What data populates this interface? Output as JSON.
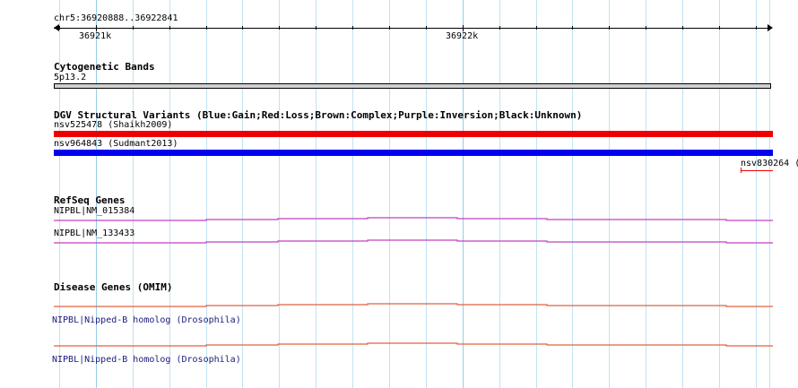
{
  "colors": {
    "grid": "#bfe3f3",
    "gain": "#0000ee",
    "loss": "#ee0000",
    "refseq": "#c040c0",
    "omim": "#e06040",
    "band": "#d0d0d0"
  },
  "ruler": {
    "region": "chr5:36920888..36922841",
    "tick_labels": [
      "36921k",
      "36922k"
    ]
  },
  "cytoband": {
    "title": "Cytogenetic Bands",
    "band_label": "5p13.2"
  },
  "dgv": {
    "title": "DGV Structural Variants (Blue:Gain;Red:Loss;Brown:Complex;Purple:Inversion;Black:Unknown)",
    "variants": [
      {
        "label": "nsv525478 (Shaikh2009)",
        "type": "loss"
      },
      {
        "label": "nsv964843 (Sudmant2013)",
        "type": "gain"
      },
      {
        "label": "nsv830264 (",
        "type": "loss"
      }
    ]
  },
  "refseq": {
    "title": "RefSeq Genes",
    "genes": [
      "NIPBL|NM_015384",
      "NIPBL|NM_133433"
    ]
  },
  "omim": {
    "title": "Disease Genes (OMIM)",
    "genes": [
      "NIPBL|Nipped-B homolog (Drosophila)",
      "NIPBL|Nipped-B homolog (Drosophila)"
    ]
  }
}
